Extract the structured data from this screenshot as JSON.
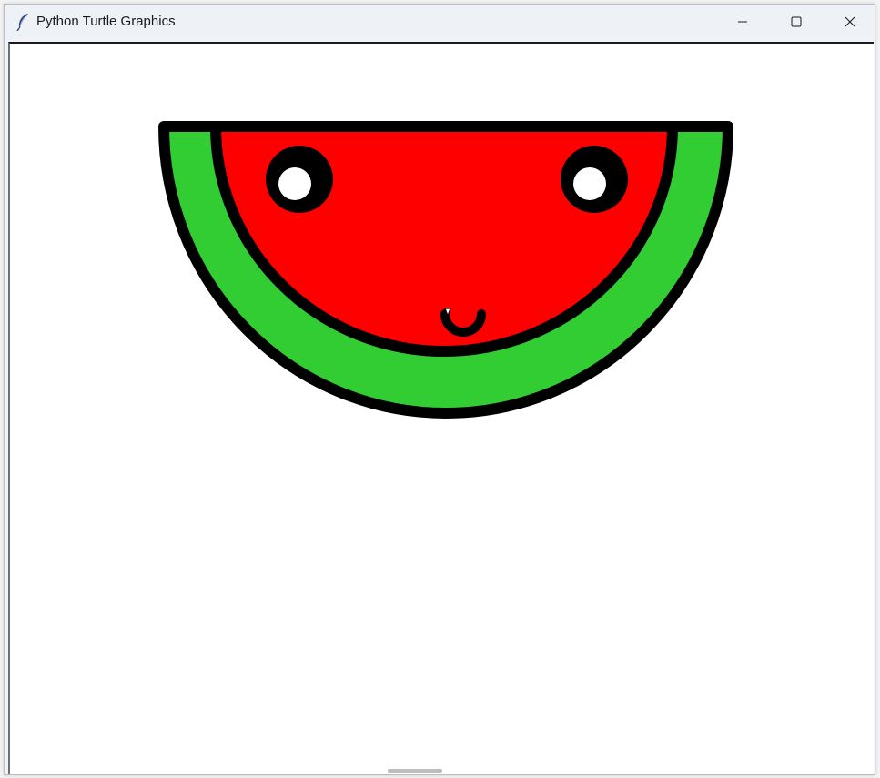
{
  "window": {
    "title": "Python Turtle Graphics",
    "icon": "feather-icon",
    "controls": {
      "minimize_icon": "minimize-icon",
      "maximize_icon": "maximize-icon",
      "close_icon": "close-icon"
    }
  },
  "canvas": {
    "background": "#ffffff",
    "drawing": {
      "subject": "watermelon-slice",
      "colors": {
        "outline": "#000000",
        "rind": "#32cd32",
        "flesh": "#ff0000",
        "eye_highlight": "#ffffff"
      },
      "turtle_cursor_icon": "turtle-arrow-icon"
    }
  }
}
